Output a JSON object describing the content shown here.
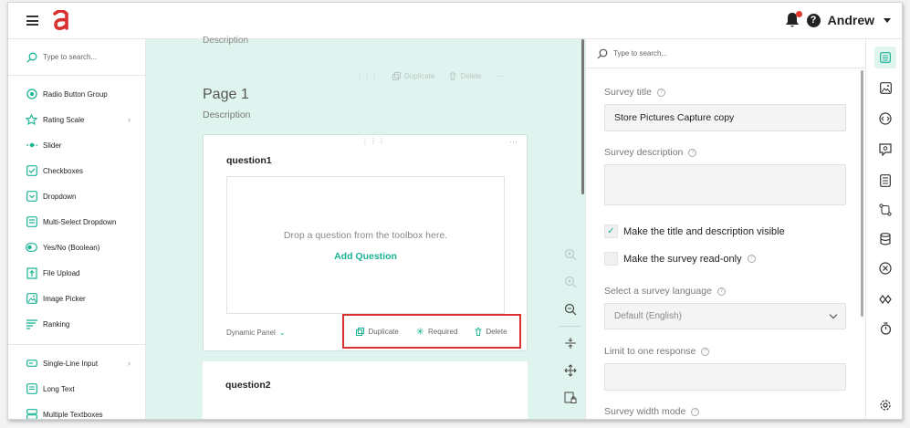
{
  "header": {
    "brand_icon": "logo-a",
    "user_name": "Andrew",
    "notification_color": "#e5392e"
  },
  "toolbox": {
    "search_placeholder": "Type to search...",
    "items": [
      {
        "label": "Radio Button Group",
        "icon": "radio-icon"
      },
      {
        "label": "Rating Scale",
        "icon": "star-icon",
        "has_submenu": true
      },
      {
        "label": "Slider",
        "icon": "slider-icon"
      },
      {
        "label": "Checkboxes",
        "icon": "checkbox-icon"
      },
      {
        "label": "Dropdown",
        "icon": "dropdown-icon"
      },
      {
        "label": "Multi-Select Dropdown",
        "icon": "multi-dropdown-icon"
      },
      {
        "label": "Yes/No (Boolean)",
        "icon": "toggle-icon"
      },
      {
        "label": "File Upload",
        "icon": "upload-icon"
      },
      {
        "label": "Image Picker",
        "icon": "image-picker-icon"
      },
      {
        "label": "Ranking",
        "icon": "ranking-icon"
      },
      {
        "label": "Single-Line Input",
        "icon": "single-line-icon",
        "has_submenu": true
      },
      {
        "label": "Long Text",
        "icon": "long-text-icon"
      },
      {
        "label": "Multiple Textboxes",
        "icon": "multi-text-icon"
      }
    ]
  },
  "canvas": {
    "ghost_description": "Description",
    "top_duplicate": "Duplicate",
    "top_delete": "Delete",
    "page_title": "Page 1",
    "page_description": "Description",
    "question1": {
      "title": "question1",
      "drop_text": "Drop a question from the toolbox here.",
      "add_question": "Add Question",
      "type_label": "Dynamic Panel",
      "actions": {
        "duplicate": "Duplicate",
        "required": "Required",
        "delete": "Delete"
      }
    },
    "question2": {
      "title": "question2"
    },
    "accent_color": "#19b394"
  },
  "properties": {
    "search_placeholder": "Type to search...",
    "survey_title_label": "Survey title",
    "survey_title_value": "Store Pictures Capture copy",
    "survey_description_label": "Survey description",
    "survey_description_value": "",
    "check_title_visible": "Make the title and description visible",
    "check_title_visible_checked": true,
    "check_read_only": "Make the survey read-only",
    "check_read_only_checked": false,
    "language_label": "Select a survey language",
    "language_value": "Default (English)",
    "limit_label": "Limit to one response",
    "limit_value": "",
    "width_mode_label": "Survey width mode"
  },
  "rail": {
    "icons": [
      "general-icon",
      "logo-image-icon",
      "navigation-icon",
      "question-settings-icon",
      "pages-icon",
      "logic-icon",
      "data-icon",
      "validation-icon",
      "display-icon",
      "timer-icon",
      "settings-icon"
    ]
  }
}
